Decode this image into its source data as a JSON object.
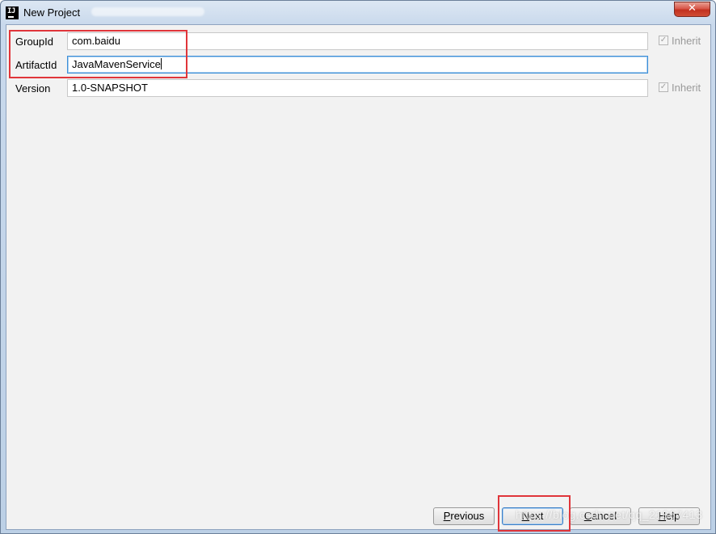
{
  "window": {
    "title": "New Project",
    "close_label": "✕"
  },
  "form": {
    "group_id": {
      "label": "GroupId",
      "value": "com.baidu",
      "inherit_label": "Inherit"
    },
    "artifact_id": {
      "label": "ArtifactId",
      "value": "JavaMavenService"
    },
    "version": {
      "label": "Version",
      "value": "1.0-SNAPSHOT",
      "inherit_label": "Inherit"
    }
  },
  "buttons": {
    "previous": {
      "mnemonic": "P",
      "rest": "revious"
    },
    "next": {
      "mnemonic": "N",
      "rest": "ext"
    },
    "cancel": {
      "mnemonic": "C",
      "rest": "ancel"
    },
    "help": {
      "mnemonic": "H",
      "rest": "elp"
    }
  },
  "watermark": "https://blog.csdn.net/qq_21867413",
  "colors": {
    "annotation_red": "#e0353a",
    "focus_blue": "#3c8fd8",
    "dialog_bg": "#f2f2f2"
  },
  "icons": {
    "app": "intellij-icon",
    "close": "close-icon",
    "inherit": "checkbox-icon"
  }
}
